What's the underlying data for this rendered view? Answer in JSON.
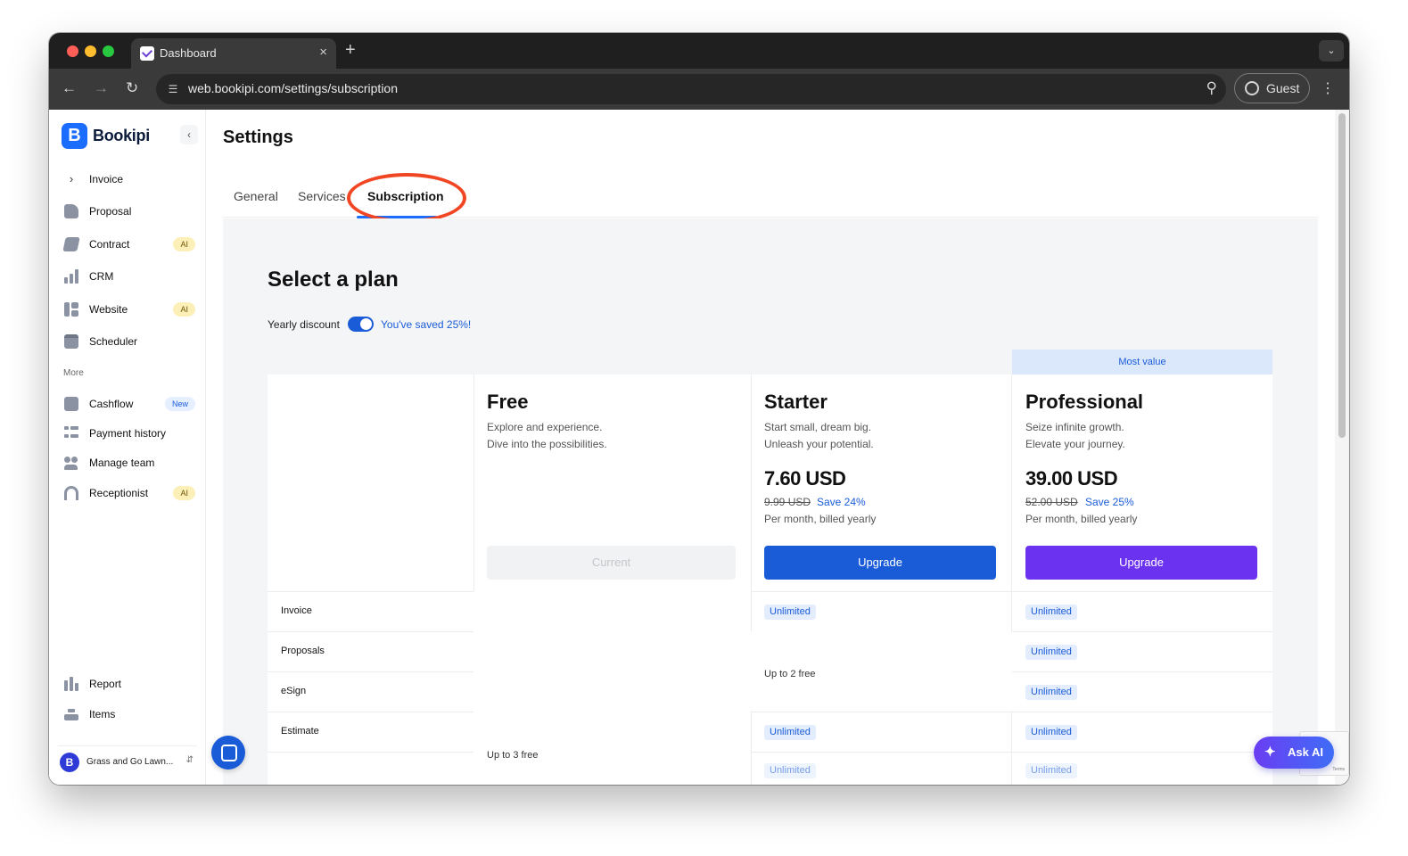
{
  "browser": {
    "tab_title": "Dashboard",
    "tab_close": "×",
    "new_tab": "+",
    "url": "web.bookipi.com/settings/subscription",
    "profile_label": "Guest"
  },
  "app": {
    "brand": "Bookipi",
    "logo_letter": "B"
  },
  "sidebar": {
    "items": [
      {
        "label": "Invoice",
        "badge": ""
      },
      {
        "label": "Proposal",
        "badge": ""
      },
      {
        "label": "Contract",
        "badge": "AI"
      },
      {
        "label": "CRM",
        "badge": ""
      },
      {
        "label": "Website",
        "badge": "AI"
      },
      {
        "label": "Scheduler",
        "badge": ""
      }
    ],
    "more_heading": "More",
    "more_items": [
      {
        "label": "Cashflow",
        "badge": "New"
      },
      {
        "label": "Payment history",
        "badge": ""
      },
      {
        "label": "Manage team",
        "badge": ""
      },
      {
        "label": "Receptionist",
        "badge": "AI"
      }
    ],
    "bottom_items": [
      {
        "label": "Report"
      },
      {
        "label": "Items"
      }
    ],
    "workspace_name": "Grass and Go Lawn...",
    "workspace_initial": "B"
  },
  "settings": {
    "title": "Settings",
    "tabs": [
      "General",
      "Services",
      "Subscription"
    ],
    "active_tab": "Subscription"
  },
  "plans": {
    "heading": "Select a plan",
    "yearly_label": "Yearly discount",
    "yearly_enabled": true,
    "saved_text": "You've saved 25%!",
    "most_value_label": "Most value",
    "list": [
      {
        "name": "Free",
        "desc1": "Explore and experience.",
        "desc2": "Dive into the possibilities.",
        "button": "Current"
      },
      {
        "name": "Starter",
        "desc1": "Start small, dream big.",
        "desc2": "Unleash your potential.",
        "price": "7.60 USD",
        "old_price": "9.99 USD",
        "save": "Save 24%",
        "billing": "Per month, billed yearly",
        "button": "Upgrade"
      },
      {
        "name": "Professional",
        "desc1": "Seize infinite growth.",
        "desc2": "Elevate your journey.",
        "price": "39.00 USD",
        "old_price": "52.00 USD",
        "save": "Save 25%",
        "billing": "Per month, billed yearly",
        "button": "Upgrade"
      }
    ],
    "features": [
      "Invoice",
      "Proposals",
      "eSign",
      "Estimate"
    ],
    "unlimited": "Unlimited",
    "free_note": "Up to 3 free",
    "starter_note": "Up to 2 free"
  },
  "widgets": {
    "ask_ai": "Ask AI",
    "recaptcha_terms": "Terms"
  },
  "colors": {
    "primary": "#1a5cd8",
    "pro_button": "#6b32f0",
    "annotation": "#f04623"
  }
}
